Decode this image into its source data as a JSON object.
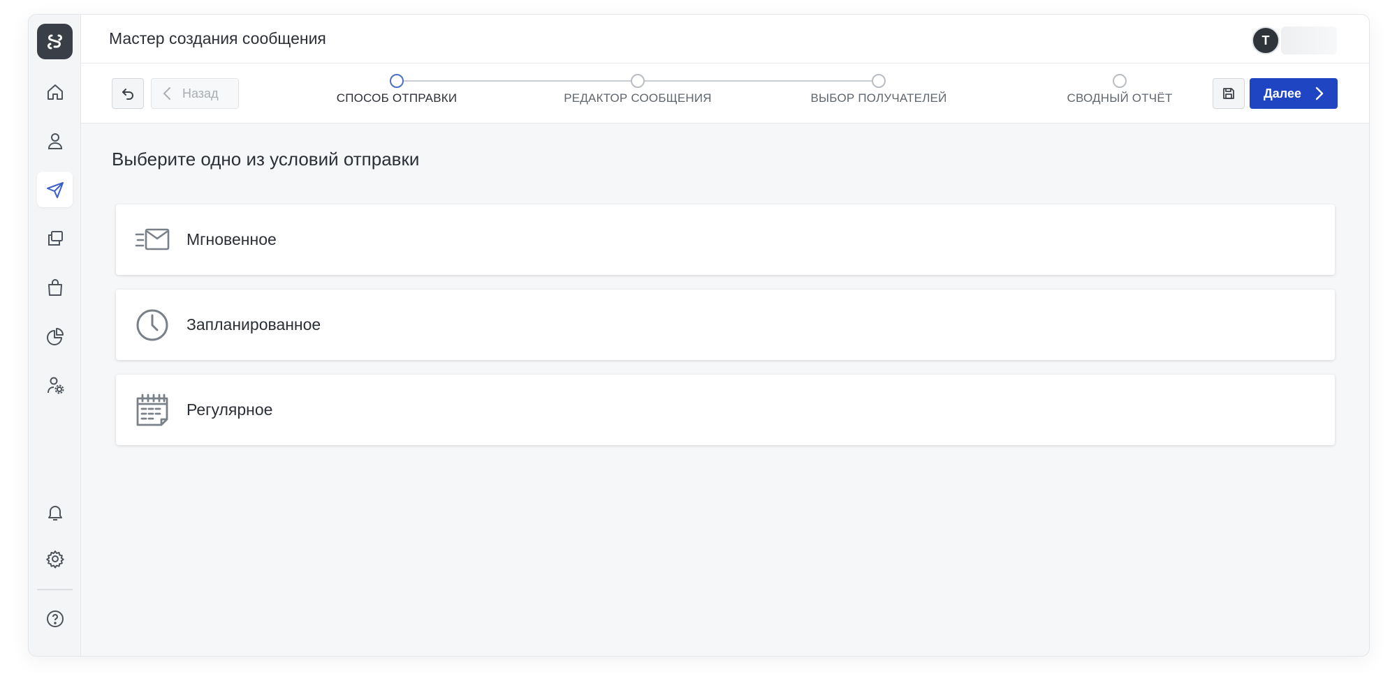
{
  "header": {
    "title": "Мастер создания сообщения",
    "user_initial": "T"
  },
  "toolbar": {
    "back_label": "Назад",
    "next_label": "Далее"
  },
  "steps": [
    {
      "label": "СПОСОБ ОТПРАВКИ",
      "active": true
    },
    {
      "label": "РЕДАКТОР СООБЩЕНИЯ",
      "active": false
    },
    {
      "label": "ВЫБОР ПОЛУЧАТЕЛЕЙ",
      "active": false
    },
    {
      "label": "СВОДНЫЙ ОТЧЁТ",
      "active": false
    }
  ],
  "content": {
    "heading": "Выберите одно из условий отправки",
    "options": [
      {
        "label": "Мгновенное",
        "icon": "fast-mail-icon"
      },
      {
        "label": "Запланированное",
        "icon": "clock-icon"
      },
      {
        "label": "Регулярное",
        "icon": "calendar-icon"
      }
    ]
  },
  "sidebar": {
    "items": [
      {
        "icon": "home-icon",
        "active": false
      },
      {
        "icon": "user-icon",
        "active": false
      },
      {
        "icon": "send-icon",
        "active": true
      },
      {
        "icon": "copy-icon",
        "active": false
      },
      {
        "icon": "bag-icon",
        "active": false
      },
      {
        "icon": "pie-chart-icon",
        "active": false
      },
      {
        "icon": "user-settings-icon",
        "active": false
      },
      {
        "icon": "bell-icon",
        "active": false
      },
      {
        "icon": "gear-icon",
        "active": false
      },
      {
        "icon": "help-icon",
        "active": false
      }
    ]
  },
  "colors": {
    "accent": "#1f45c2",
    "active_step": "#4c6fc6",
    "sidebar_active_icon": "#3a5fc8"
  }
}
